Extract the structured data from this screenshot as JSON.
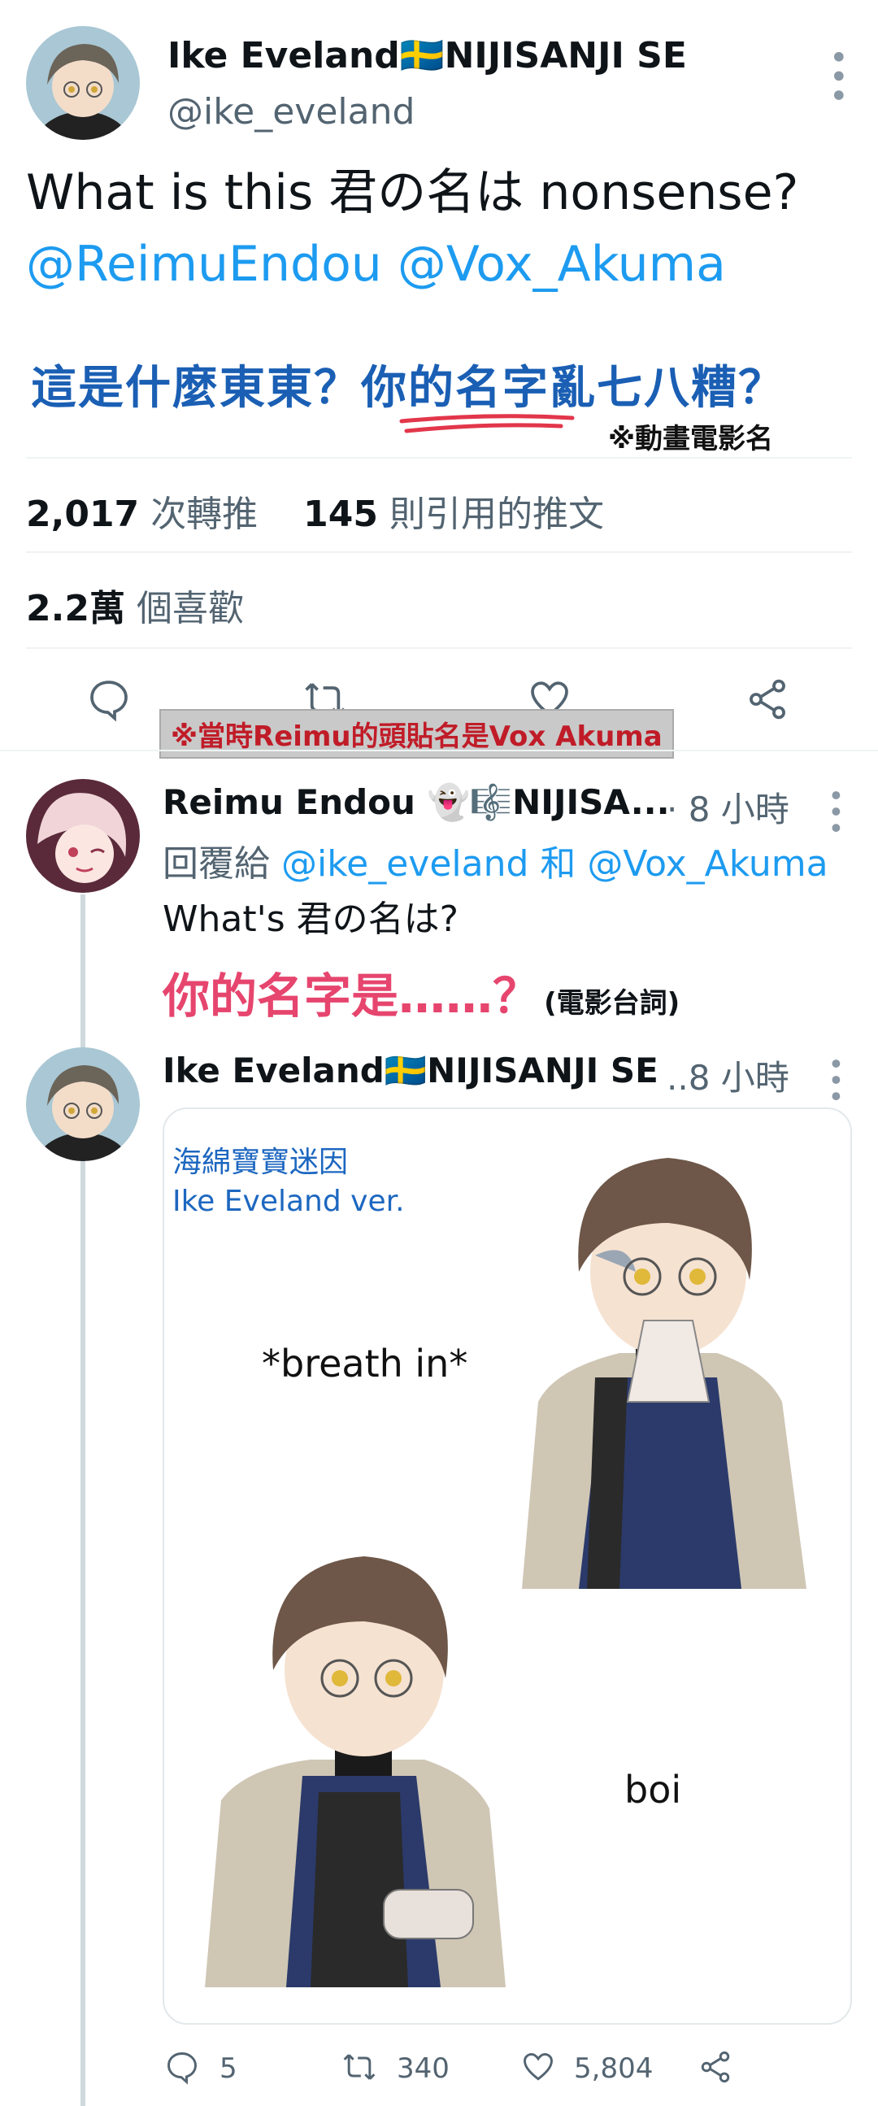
{
  "main_tweet": {
    "display_name": "Ike Eveland",
    "flag": "🇸🇪",
    "name_suffix": "NIJISANJI SE",
    "handle": "@ike_eveland",
    "text_line1": "What is this 君の名は nonsense?",
    "mention1": "@ReimuEndou",
    "mention2": "@Vox_Akuma",
    "translation_note_a": "這是什麼東東？",
    "translation_note_b": "你的名字亂七八糟？",
    "translation_footnote": "※動畫電影名",
    "retweets_count": "2,017",
    "retweets_label": "次轉推",
    "quotes_count": "145",
    "quotes_label": "則引用的推文",
    "likes_count": "2.2萬",
    "likes_label": "個喜歡",
    "avatar_note": "※當時Reimu的頭貼名是Vox Akuma"
  },
  "reply1": {
    "display_name": "Reimu Endou",
    "name_suffix": "NIJISA...",
    "time": "· 8 小時",
    "replying_prefix": "回覆給",
    "replying_to1": "@ike_eveland",
    "replying_and": "和",
    "replying_to2": "@Vox_Akuma",
    "text": "What's 君の名は?",
    "translation": "你的名字是……？",
    "translation_note": "(電影台詞)"
  },
  "reply2": {
    "display_name": "Ike Eveland",
    "flag": "🇸🇪",
    "name_suffix": "NIJISANJI SE",
    "time": "..8 小時",
    "meme_title_line1": "海綿寶寶迷因",
    "meme_title_line2": "Ike Eveland ver.",
    "meme_text1": "*breath in*",
    "meme_text2": "boi",
    "replies": "5",
    "retweets": "340",
    "likes": "5,804"
  },
  "colors": {
    "link": "#1d9bf0",
    "note_blue": "#1a5fb4",
    "pink": "#e6456e",
    "banner_red": "#c01c28"
  },
  "icons": [
    "kebab-icon",
    "reply-icon",
    "retweet-icon",
    "like-icon",
    "share-icon"
  ]
}
